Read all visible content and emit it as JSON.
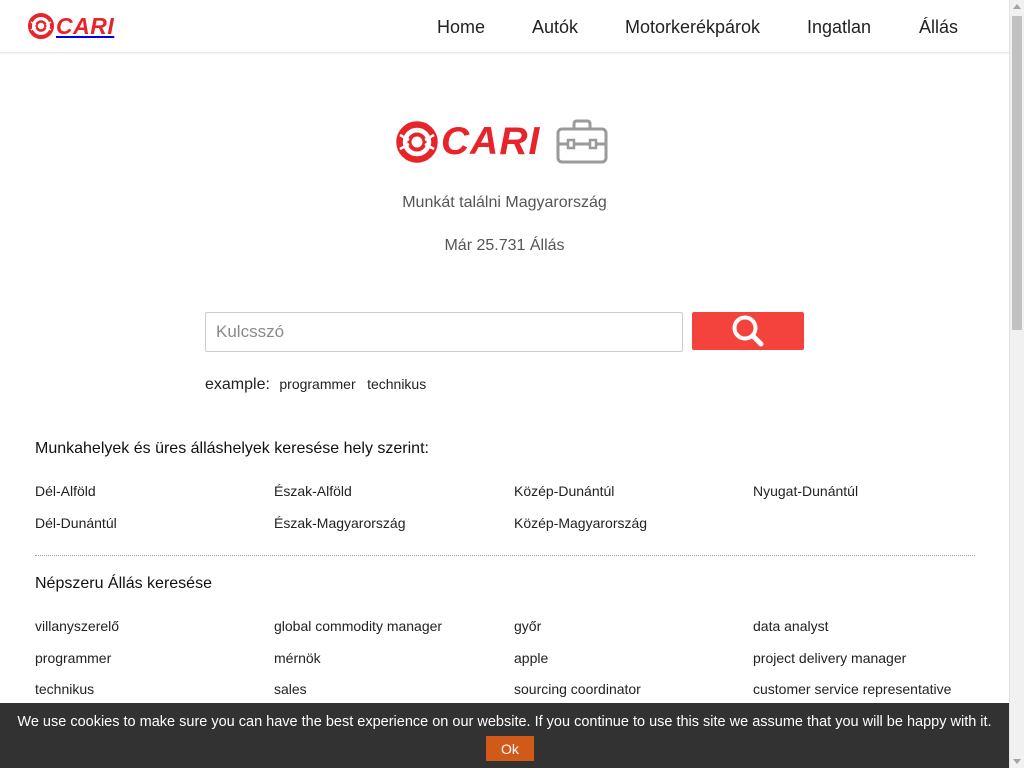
{
  "header": {
    "logo_text": "CARI",
    "nav": [
      "Home",
      "Autók",
      "Motorkerékpárok",
      "Ingatlan",
      "Állás"
    ]
  },
  "hero": {
    "logo_text": "CARI",
    "tagline": "Munkát találni Magyarország",
    "count_text": "Már 25.731 Állás"
  },
  "search": {
    "placeholder": "Kulcsszó",
    "value": "",
    "example_label": "example:",
    "examples": [
      "programmer",
      "technikus"
    ]
  },
  "location_section": {
    "title": "Munkahelyek és üres álláshelyek keresése hely szerint:",
    "links": [
      "Dél-Alföld",
      "Észak-Alföld",
      "Közép-Dunántúl",
      "Nyugat-Dunántúl",
      "Dél-Dunántúl",
      "Észak-Magyarország",
      "Közép-Magyarország"
    ]
  },
  "popular_section": {
    "title": "Népszeru Állás keresése",
    "links": [
      "villanyszerelő",
      "global commodity manager",
      "győr",
      "data analyst",
      "programmer",
      "mérnök",
      "apple",
      "project delivery manager",
      "technikus",
      "sales",
      "sourcing coordinator",
      "customer service representative"
    ]
  },
  "cookie": {
    "message": "We use cookies to make sure you can have the best experience on our website. If you continue to use this site we assume that you will be happy with it.",
    "ok_label": "Ok"
  },
  "colors": {
    "brand_red": "#e8242b",
    "search_button": "#f4433c",
    "cookie_bg": "#323232",
    "ok_button": "#d15a1a"
  },
  "icons": {
    "search": "search-icon",
    "briefcase": "briefcase-icon",
    "logo_mark": "cari-logo-mark"
  }
}
